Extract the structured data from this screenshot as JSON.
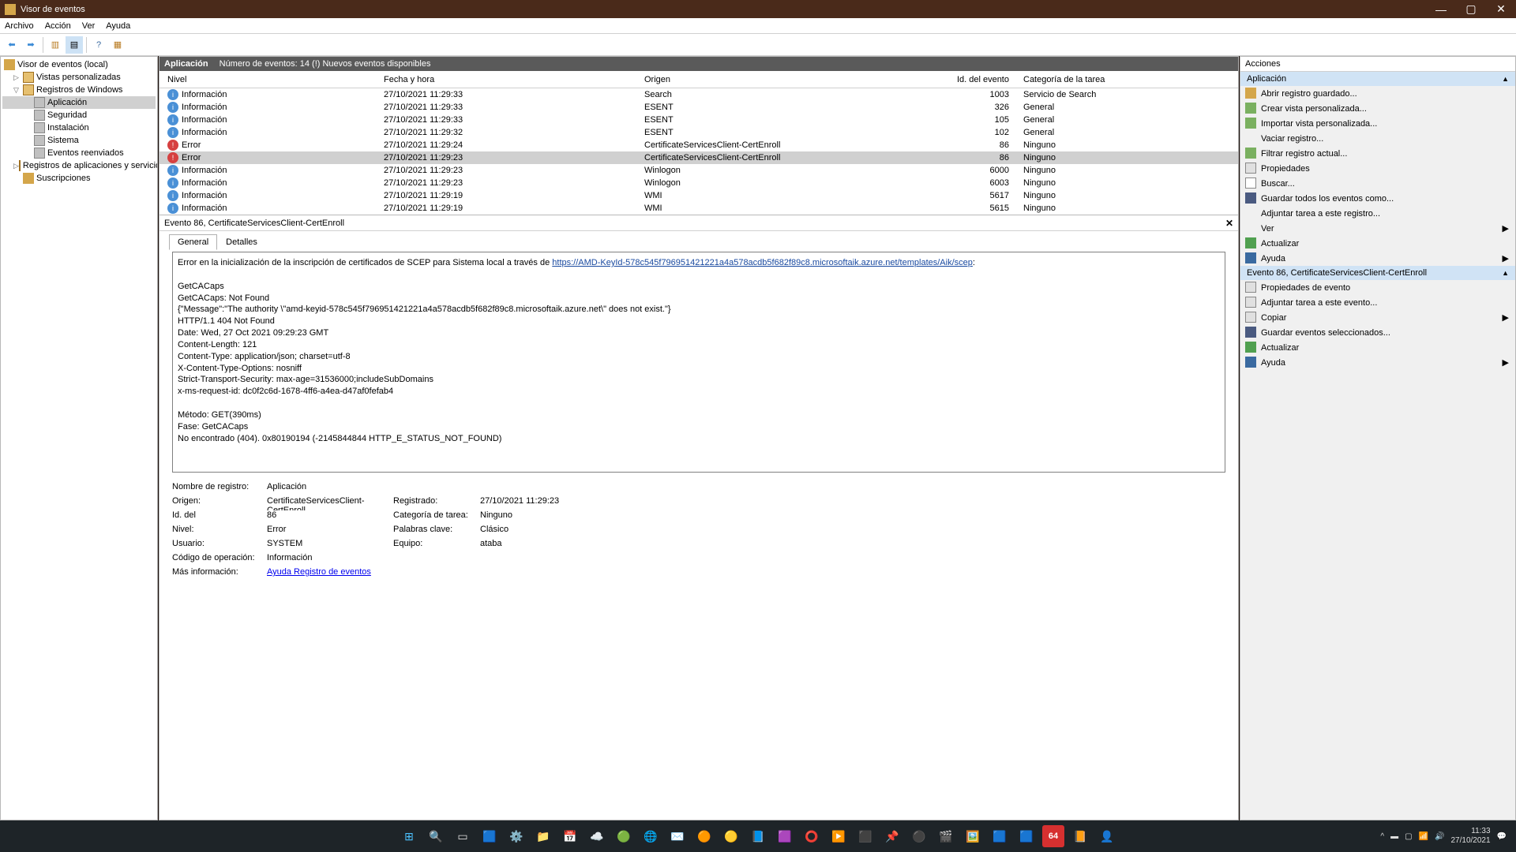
{
  "window": {
    "title": "Visor de eventos"
  },
  "menu": {
    "archivo": "Archivo",
    "accion": "Acción",
    "ver": "Ver",
    "ayuda": "Ayuda"
  },
  "tree": {
    "root": "Visor de eventos (local)",
    "custom": "Vistas personalizadas",
    "winlogs": "Registros de Windows",
    "app": "Aplicación",
    "sec": "Seguridad",
    "setup": "Instalación",
    "sys": "Sistema",
    "fwd": "Eventos reenviados",
    "appsvc": "Registros de aplicaciones y servicios",
    "subs": "Suscripciones"
  },
  "logheader": {
    "name": "Aplicación",
    "status": "Número de eventos: 14 (!) Nuevos eventos disponibles"
  },
  "cols": {
    "level": "Nivel",
    "date": "Fecha y hora",
    "source": "Origen",
    "id": "Id. del evento",
    "cat": "Categoría de la tarea"
  },
  "levels": {
    "info": "Información",
    "err": "Error"
  },
  "rows": [
    {
      "level": "info",
      "date": "27/10/2021 11:29:33",
      "source": "Search",
      "id": "1003",
      "cat": "Servicio de Search"
    },
    {
      "level": "info",
      "date": "27/10/2021 11:29:33",
      "source": "ESENT",
      "id": "326",
      "cat": "General"
    },
    {
      "level": "info",
      "date": "27/10/2021 11:29:33",
      "source": "ESENT",
      "id": "105",
      "cat": "General"
    },
    {
      "level": "info",
      "date": "27/10/2021 11:29:32",
      "source": "ESENT",
      "id": "102",
      "cat": "General"
    },
    {
      "level": "err",
      "date": "27/10/2021 11:29:24",
      "source": "CertificateServicesClient-CertEnroll",
      "id": "86",
      "cat": "Ninguno"
    },
    {
      "level": "err",
      "date": "27/10/2021 11:29:23",
      "source": "CertificateServicesClient-CertEnroll",
      "id": "86",
      "cat": "Ninguno",
      "sel": true
    },
    {
      "level": "info",
      "date": "27/10/2021 11:29:23",
      "source": "Winlogon",
      "id": "6000",
      "cat": "Ninguno"
    },
    {
      "level": "info",
      "date": "27/10/2021 11:29:23",
      "source": "Winlogon",
      "id": "6003",
      "cat": "Ninguno"
    },
    {
      "level": "info",
      "date": "27/10/2021 11:29:19",
      "source": "WMI",
      "id": "5617",
      "cat": "Ninguno"
    },
    {
      "level": "info",
      "date": "27/10/2021 11:29:19",
      "source": "WMI",
      "id": "5615",
      "cat": "Ninguno"
    }
  ],
  "detail": {
    "title": "Evento 86, CertificateServicesClient-CertEnroll",
    "tabs": {
      "general": "General",
      "details": "Detalles"
    },
    "body_intro": "Error en la inicialización de la inscripción de certificados de SCEP para Sistema local a través de ",
    "body_link": "https://AMD-KeyId-578c545f796951421221a4a578acdb5f682f89c8.microsoftaik.azure.net/templates/Aik/scep",
    "body_rest": ":\n\nGetCACaps\nGetCACaps: Not Found\n{\"Message\":\"The authority \\\"amd-keyid-578c545f796951421221a4a578acdb5f682f89c8.microsoftaik.azure.net\\\" does not exist.\"}\nHTTP/1.1 404 Not Found\nDate: Wed, 27 Oct 2021 09:29:23 GMT\nContent-Length: 121\nContent-Type: application/json; charset=utf-8\nX-Content-Type-Options: nosniff\nStrict-Transport-Security: max-age=31536000;includeSubDomains\nx-ms-request-id: dc0f2c6d-1678-4ff6-a4ea-d47af0fefab4\n\nMétodo: GET(390ms)\nFase: GetCACaps\nNo encontrado (404). 0x80190194 (-2145844844 HTTP_E_STATUS_NOT_FOUND)"
  },
  "props": {
    "logname_l": "Nombre de registro:",
    "logname_v": "Aplicación",
    "source_l": "Origen:",
    "source_v": "CertificateServicesClient-CertEnroll",
    "logged_l": "Registrado:",
    "logged_v": "27/10/2021 11:29:23",
    "id_l": "Id. del",
    "id_v": "86",
    "cat_l": "Categoría de tarea:",
    "cat_v": "Ninguno",
    "lvl_l": "Nivel:",
    "lvl_v": "Error",
    "kw_l": "Palabras clave:",
    "kw_v": "Clásico",
    "user_l": "Usuario:",
    "user_v": "SYSTEM",
    "comp_l": "Equipo:",
    "comp_v": "ataba",
    "op_l": "Código de operación:",
    "op_v": "Información",
    "more_l": "Más información:",
    "more_v": "Ayuda Registro de eventos"
  },
  "actions": {
    "title": "Acciones",
    "sec1": "Aplicación",
    "a1": "Abrir registro guardado...",
    "a2": "Crear vista personalizada...",
    "a3": "Importar vista personalizada...",
    "a4": "Vaciar registro...",
    "a5": "Filtrar registro actual...",
    "a6": "Propiedades",
    "a7": "Buscar...",
    "a8": "Guardar todos los eventos como...",
    "a9": "Adjuntar tarea a este registro...",
    "a10": "Ver",
    "a11": "Actualizar",
    "a12": "Ayuda",
    "sec2": "Evento 86, CertificateServicesClient-CertEnroll",
    "b1": "Propiedades de evento",
    "b2": "Adjuntar tarea a este evento...",
    "b3": "Copiar",
    "b4": "Guardar eventos seleccionados...",
    "b5": "Actualizar",
    "b6": "Ayuda"
  },
  "taskbar": {
    "time": "11:33",
    "date": "27/10/2021"
  }
}
